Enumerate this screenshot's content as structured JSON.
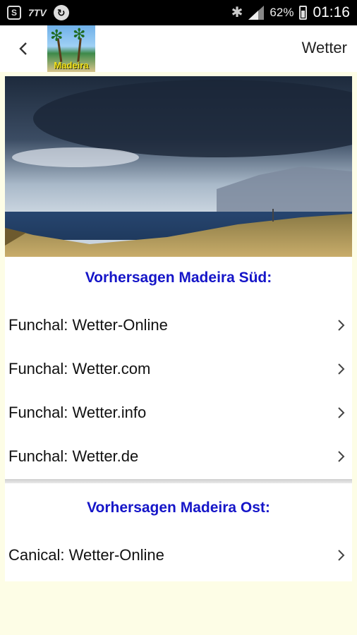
{
  "status_bar": {
    "left_icons": [
      "sim-box-icon",
      "7tv-icon",
      "sync-icon"
    ],
    "sim_badge": "S",
    "tv_label": "7TV",
    "sync_glyph": "↻",
    "battery_percent": "62%",
    "time": "01:16"
  },
  "app_bar": {
    "logo_text": "Madeira",
    "title": "Wetter"
  },
  "hero": {
    "description_icon": "weather-photo"
  },
  "sections": [
    {
      "title": "Vorhersagen Madeira Süd:",
      "items": [
        {
          "label": "Funchal: Wetter-Online"
        },
        {
          "label": "Funchal: Wetter.com"
        },
        {
          "label": "Funchal: Wetter.info"
        },
        {
          "label": "Funchal: Wetter.de"
        }
      ]
    },
    {
      "title": "Vorhersagen Madeira Ost:",
      "items": [
        {
          "label": "Canical: Wetter-Online"
        }
      ]
    }
  ],
  "colors": {
    "section_title": "#1515C8",
    "background": "#FDFDE6",
    "status_bar": "#000000"
  }
}
